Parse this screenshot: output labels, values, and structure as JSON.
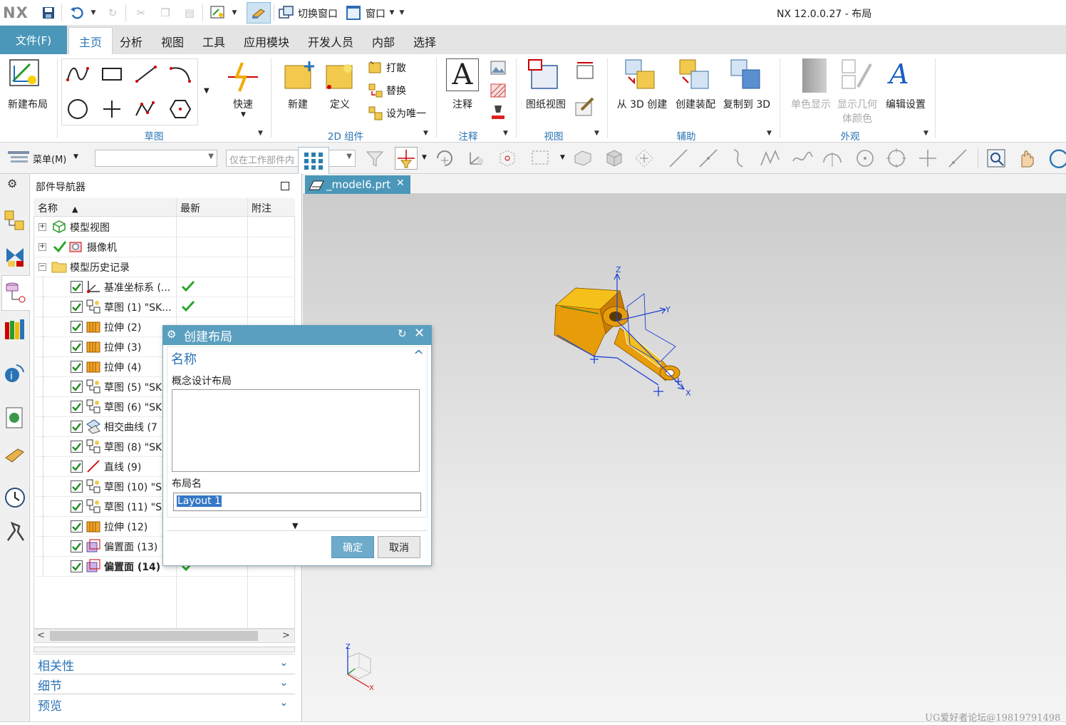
{
  "titlebar": {
    "logo": "NX",
    "switch_window": "切换窗口",
    "window": "窗口",
    "app_title": "NX 12.0.0.27 - 布局"
  },
  "menu": {
    "file": "文件(F)",
    "tabs": [
      "主页",
      "分析",
      "视图",
      "工具",
      "应用模块",
      "开发人员",
      "内部",
      "选择"
    ]
  },
  "ribbon": {
    "new_layout": "新建布局",
    "quick": "快速",
    "sketch_group": "草图",
    "new": "新建",
    "define": "定义",
    "explode": "打散",
    "replace": "替换",
    "set_unique": "设为唯一",
    "component_group": "2D 组件",
    "annotation": "注释",
    "annotation_group": "注释",
    "drawing_view": "图纸视图",
    "view_group": "视图",
    "create_from_3d": "从 3D 创建",
    "create_assembly": "创建装配",
    "copy_to_3d": "复制到 3D",
    "aux_group": "辅助",
    "mono_display": "单色显示",
    "show_geom_color_1": "显示几何",
    "show_geom_color_2": "体颜色",
    "edit_settings": "编辑设置",
    "appearance_group": "外观"
  },
  "toolbar": {
    "menu_label": "菜单(M)",
    "filter_placeholder": "仅在工作部件内"
  },
  "navigator": {
    "title": "部件导航器",
    "columns": [
      "名称",
      "最新",
      "附注"
    ],
    "rows": [
      {
        "label": "模型视图",
        "level": 0,
        "icon": "model-views-icon",
        "expander": "+",
        "check": false,
        "latest": false,
        "bold": false
      },
      {
        "label": "摄像机",
        "level": 0,
        "icon": "camera-icon",
        "expander": "+",
        "check": false,
        "latest": false,
        "bold": false
      },
      {
        "label": "模型历史记录",
        "level": 0,
        "icon": "folder-icon",
        "expander": "−",
        "check": false,
        "latest": false,
        "bold": false
      },
      {
        "label": "基准坐标系 (...",
        "level": 1,
        "icon": "datum-csys-icon",
        "check": true,
        "latest": true,
        "bold": false
      },
      {
        "label": "草图 (1) \"SK...",
        "level": 1,
        "icon": "sketch-icon",
        "check": true,
        "latest": true,
        "bold": false
      },
      {
        "label": "拉伸 (2)",
        "level": 1,
        "icon": "extrude-icon",
        "check": true,
        "latest": false,
        "bold": false
      },
      {
        "label": "拉伸 (3)",
        "level": 1,
        "icon": "extrude-icon",
        "check": true,
        "latest": false,
        "bold": false
      },
      {
        "label": "拉伸 (4)",
        "level": 1,
        "icon": "extrude-icon",
        "check": true,
        "latest": false,
        "bold": false
      },
      {
        "label": "草图 (5) \"SK",
        "level": 1,
        "icon": "sketch-icon",
        "check": true,
        "latest": false,
        "bold": false
      },
      {
        "label": "草图 (6) \"SK",
        "level": 1,
        "icon": "sketch-icon",
        "check": true,
        "latest": false,
        "bold": false
      },
      {
        "label": "相交曲线 (7",
        "level": 1,
        "icon": "intersect-curve-icon",
        "check": true,
        "latest": false,
        "bold": false
      },
      {
        "label": "草图 (8) \"SK",
        "level": 1,
        "icon": "sketch-icon",
        "check": true,
        "latest": false,
        "bold": false
      },
      {
        "label": "直线 (9)",
        "level": 1,
        "icon": "line-icon",
        "check": true,
        "latest": false,
        "bold": false
      },
      {
        "label": "草图 (10) \"S",
        "level": 1,
        "icon": "sketch-icon",
        "check": true,
        "latest": false,
        "bold": false
      },
      {
        "label": "草图 (11) \"S",
        "level": 1,
        "icon": "sketch-icon",
        "check": true,
        "latest": false,
        "bold": false
      },
      {
        "label": "拉伸 (12)",
        "level": 1,
        "icon": "extrude-icon",
        "check": true,
        "latest": false,
        "bold": false
      },
      {
        "label": "偏置面 (13)",
        "level": 1,
        "icon": "offset-face-icon",
        "check": true,
        "latest": false,
        "bold": false
      },
      {
        "label": "偏置面 (14)",
        "level": 1,
        "icon": "offset-face-icon",
        "check": true,
        "latest": true,
        "bold": true
      }
    ],
    "panels": [
      "相关性",
      "细节",
      "预览"
    ]
  },
  "graphics": {
    "tab_label": "_model6.prt",
    "axis_z": "Z",
    "axis_y": "Y",
    "axis_x": "X"
  },
  "dialog": {
    "title": "创建布局",
    "section": "名称",
    "label_concept": "概念设计布局",
    "label_layout_name": "布局名",
    "layout_name_value": "Layout 1",
    "ok": "确定",
    "cancel": "取消"
  },
  "watermark": "UG爱好者论坛@19819791498",
  "colors": {
    "accent": "#4a97b9",
    "link_blue": "#2a73b5",
    "check_green": "#2aa52a",
    "model_orange": "#e79c0a"
  }
}
